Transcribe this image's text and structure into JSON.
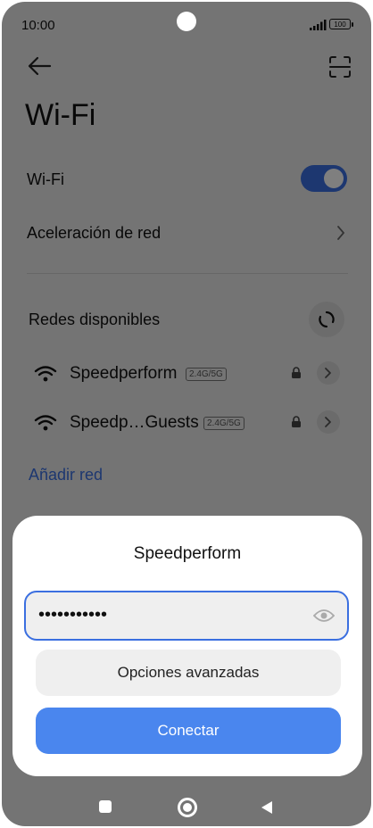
{
  "status_bar": {
    "time": "10:00",
    "battery": "100"
  },
  "header": {
    "title": "Wi-Fi"
  },
  "settings": {
    "wifi_label": "Wi-Fi",
    "wifi_enabled": true,
    "acceleration_label": "Aceleración de red"
  },
  "networks": {
    "section_title": "Redes disponibles",
    "items": [
      {
        "name": "Speedperform",
        "badge": "2.4G/5G",
        "secured": true
      },
      {
        "name": "Speedp…Guests",
        "badge": "2.4G/5G",
        "secured": true
      }
    ],
    "add_label": "Añadir red"
  },
  "dialog": {
    "title": "Speedperform",
    "password_value": "•••••••••••",
    "advanced_label": "Opciones avanzadas",
    "connect_label": "Conectar"
  },
  "colors": {
    "accent": "#3b6fe0",
    "connect": "#4a86ee"
  },
  "icons": [
    "back-arrow-icon",
    "scan-icon",
    "wifi-icon",
    "lock-icon",
    "chevron-right-icon",
    "refresh-icon",
    "eye-icon"
  ]
}
